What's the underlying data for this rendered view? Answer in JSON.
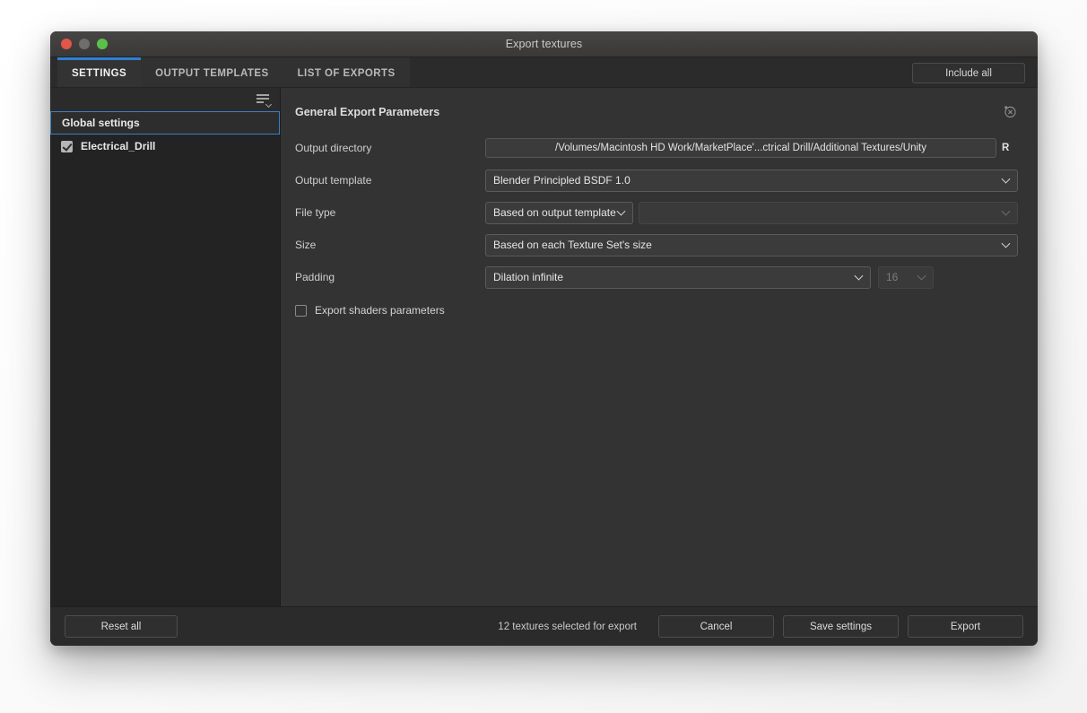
{
  "window": {
    "title": "Export textures",
    "traffic_lights": [
      "close",
      "minimize",
      "zoom"
    ]
  },
  "tabs": [
    {
      "label": "SETTINGS",
      "active": true
    },
    {
      "label": "OUTPUT TEMPLATES",
      "active": false
    },
    {
      "label": "LIST OF EXPORTS",
      "active": false
    }
  ],
  "toolbar": {
    "include_all_label": "Include all"
  },
  "sidebar": {
    "filter_icon": "list-filter-icon",
    "items": [
      {
        "label": "Global settings",
        "selected": true,
        "checkbox": false
      },
      {
        "label": "Electrical_Drill",
        "selected": false,
        "checkbox": true,
        "checked": true
      }
    ]
  },
  "main": {
    "panel_title": "General Export Parameters",
    "revert_icon": "revert-history-icon",
    "fields": {
      "output_directory": {
        "label": "Output directory",
        "value": "/Volumes/Macintosh HD Work/MarketPlace'...ctrical Drill/Additional Textures/Unity",
        "browse_label": "R"
      },
      "output_template": {
        "label": "Output template",
        "value": "Blender Principled BSDF 1.0"
      },
      "file_type": {
        "label": "File type",
        "value": "Based on output template",
        "secondary_value": ""
      },
      "size": {
        "label": "Size",
        "value": "Based on each Texture Set's size"
      },
      "padding": {
        "label": "Padding",
        "value": "Dilation infinite",
        "amount": "16"
      },
      "export_shaders": {
        "label": "Export shaders parameters",
        "checked": false
      }
    }
  },
  "footer": {
    "reset_label": "Reset all",
    "status": "12 textures selected for export",
    "cancel_label": "Cancel",
    "save_label": "Save settings",
    "export_label": "Export"
  },
  "colors": {
    "accent_blue": "#2f7fd6",
    "window_bg": "#2b2b2b",
    "panel_bg": "#333333",
    "sidebar_bg": "#232323",
    "traffic_red": "#e2564a",
    "traffic_gray": "#6e6e6e",
    "traffic_green": "#5bc04a"
  }
}
